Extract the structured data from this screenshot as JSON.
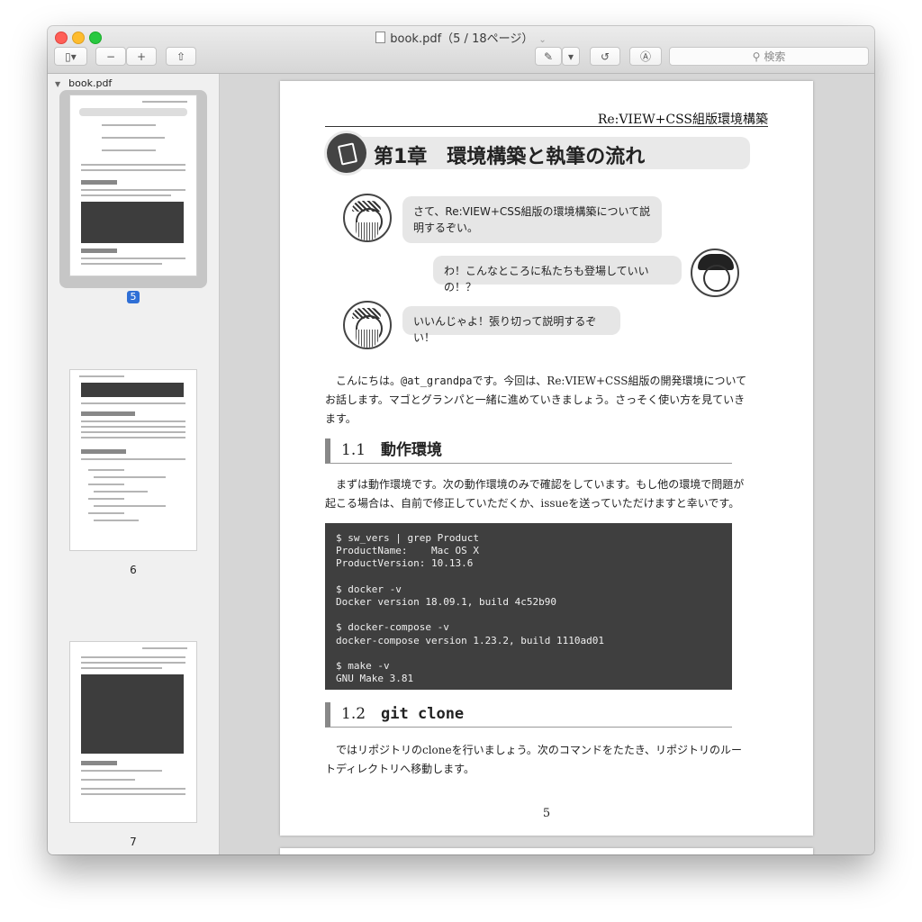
{
  "window": {
    "title": "book.pdf（5 / 18ページ）",
    "search_placeholder": "検索",
    "toolbar": {
      "sidebar_toggle": "▯▾",
      "zoom_out": "−",
      "zoom_in": "+",
      "share": "⇧",
      "markup": "✎",
      "markup_menu": "▾",
      "rotate": "↺",
      "annotate": "Ⓐ"
    }
  },
  "sidebar": {
    "file_label": "book.pdf",
    "pages": [
      {
        "number": "5",
        "selected": true
      },
      {
        "number": "6",
        "selected": false
      },
      {
        "number": "7",
        "selected": false
      }
    ]
  },
  "page": {
    "running_header": "Re:VIEW+CSS組版環境構築",
    "chapter_title": "第1章　環境構築と執筆の流れ",
    "dialog": [
      {
        "speaker": "grandpa",
        "text": "さて、Re:VIEW+CSS組版の環境構築について説明するぞい。"
      },
      {
        "speaker": "girl",
        "text": "わ！こんなところに私たちも登場していいの！？"
      },
      {
        "speaker": "grandpa",
        "text": "いいんじゃよ！張り切って説明するぞい！"
      }
    ],
    "intro_pre": "こんにちは。",
    "intro_handle": "@at_grandpa",
    "intro_post": "です。今回は、Re:VIEW+CSS組版の開発環境についてお話します。マゴとグランパと一緒に進めていきましょう。さっそく使い方を見ていきます。",
    "section1_num": "1.1",
    "section1_title": "動作環境",
    "section1_body": "まずは動作環境です。次の動作環境のみで確認をしています。もし他の環境で問題が起こる場合は、自前で修正していただくか、issueを送っていただけますと幸いです。",
    "code": "$ sw_vers | grep Product\nProductName:    Mac OS X\nProductVersion: 10.13.6\n\n$ docker -v\nDocker version 18.09.1, build 4c52b90\n\n$ docker-compose -v\ndocker-compose version 1.23.2, build 1110ad01\n\n$ make -v\nGNU Make 3.81",
    "section2_num": "1.2",
    "section2_title": "git clone",
    "section2_body": "ではリポジトリのcloneを行いましょう。次のコマンドをたたき、リポジトリのルートディレクトリへ移動します。",
    "page_number": "5"
  }
}
